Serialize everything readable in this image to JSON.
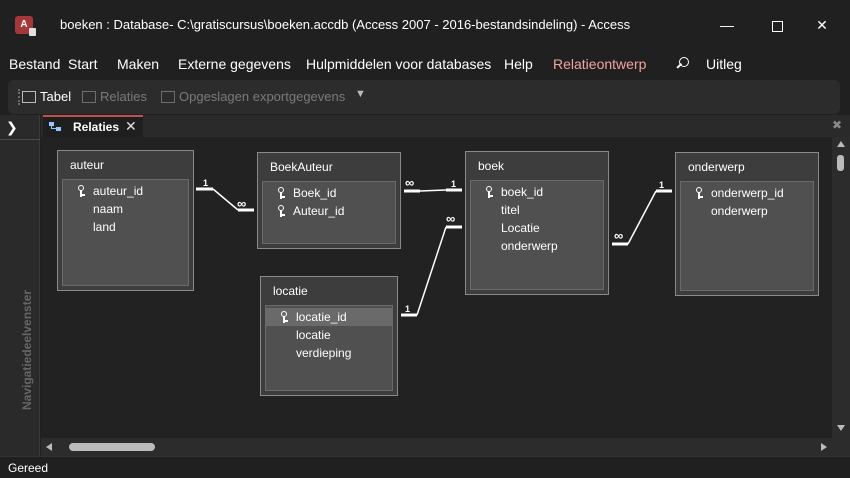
{
  "window": {
    "app_icon_letter": "A",
    "title": "boeken : Database- C:\\gratiscursus\\boeken.accdb (Access 2007 - 2016-bestandsindeling)  -  Access"
  },
  "menu": {
    "items": [
      "Bestand",
      "Start",
      "Maken",
      "Externe gegevens",
      "Hulpmiddelen voor databases",
      "Help",
      "Relatieontwerp"
    ],
    "active": "Relatieontwerp",
    "help_search_label": "Uitleg"
  },
  "ribbon": {
    "tabel_label": "Tabel",
    "relaties_label": "Relaties",
    "export_label": "Opgeslagen exportgegevens"
  },
  "nav_pane": {
    "label": "Navigatiedeelvenster"
  },
  "document": {
    "tab_label": "Relaties"
  },
  "tables": {
    "auteur": {
      "title": "auteur",
      "fields": [
        {
          "name": "auteur_id",
          "key": true
        },
        {
          "name": "naam",
          "key": false
        },
        {
          "name": "land",
          "key": false
        }
      ]
    },
    "boekauteur": {
      "title": "BoekAuteur",
      "fields": [
        {
          "name": "Boek_id",
          "key": true
        },
        {
          "name": "Auteur_id",
          "key": true
        }
      ]
    },
    "boek": {
      "title": "boek",
      "fields": [
        {
          "name": "boek_id",
          "key": true
        },
        {
          "name": "titel",
          "key": false
        },
        {
          "name": "Locatie",
          "key": false
        },
        {
          "name": "onderwerp",
          "key": false
        }
      ]
    },
    "onderwerp": {
      "title": "onderwerp",
      "fields": [
        {
          "name": "onderwerp_id",
          "key": true
        },
        {
          "name": "onderwerp",
          "key": false
        }
      ]
    },
    "locatie": {
      "title": "locatie",
      "fields": [
        {
          "name": "locatie_id",
          "key": true,
          "selected": true
        },
        {
          "name": "locatie",
          "key": false
        },
        {
          "name": "verdieping",
          "key": false
        }
      ]
    }
  },
  "relationships": {
    "one_symbol": "1",
    "many_symbol": "∞"
  },
  "status": {
    "text": "Gereed"
  }
}
